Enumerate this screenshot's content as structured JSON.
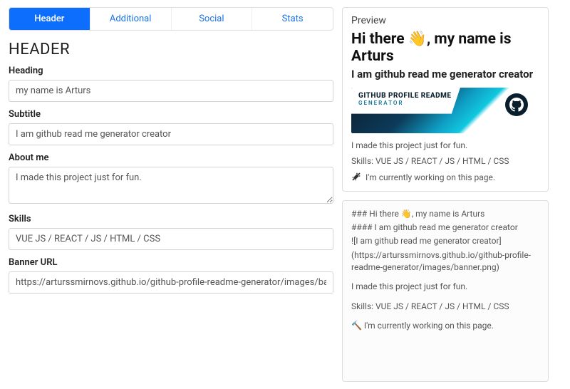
{
  "tabs": [
    {
      "label": "Header",
      "active": true
    },
    {
      "label": "Additional",
      "active": false
    },
    {
      "label": "Social",
      "active": false
    },
    {
      "label": "Stats",
      "active": false
    }
  ],
  "section_title": "HEADER",
  "fields": {
    "heading": {
      "label": "Heading",
      "value": "my name is Arturs"
    },
    "subtitle": {
      "label": "Subtitle",
      "value": "I am github read me generator creator"
    },
    "about": {
      "label": "About me",
      "value": "I made this project just for fun."
    },
    "skills": {
      "label": "Skills",
      "value": "VUE JS / REACT / JS / HTML / CSS"
    },
    "banner_url": {
      "label": "Banner URL",
      "value": "https://arturssmirnovs.github.io/github-profile-readme-generator/images/banner.png"
    }
  },
  "preview": {
    "label": "Preview",
    "heading": "Hi there 👋, my name is Arturs",
    "subtitle": "I am github read me generator creator",
    "banner_title": "GITHUB PROFILE README",
    "banner_sub": "GENERATOR",
    "about": "I made this project just for fun.",
    "skills": "Skills: VUE JS / REACT / JS / HTML / CSS",
    "working": "I'm currently working on this page."
  },
  "markdown": {
    "line1": "### Hi there 👋, my name is Arturs",
    "line2": "#### I am github read me generator creator",
    "line3": "![I am github read me generator creator]",
    "line4": "(https://arturssmirnovs.github.io/github-profile-readme-generator/images/banner.png)",
    "line5": "I made this project just for fun.",
    "line6": "Skills: VUE JS / REACT / JS / HTML / CSS",
    "line7": "🔨 I'm currently working on this page."
  }
}
